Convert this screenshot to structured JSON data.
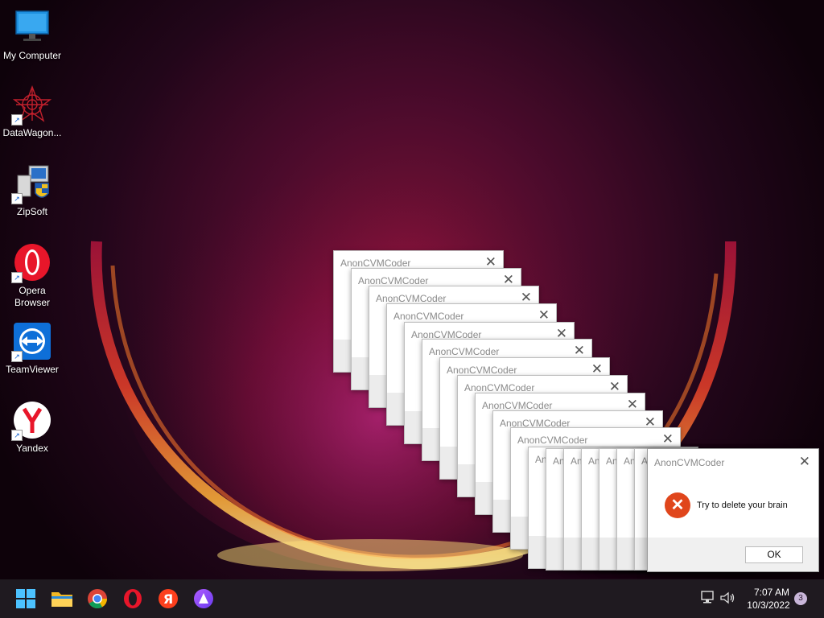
{
  "desktop": {
    "icons": [
      {
        "label": "My Computer",
        "icon": "monitor-icon",
        "shortcut": false
      },
      {
        "label": "DataWagon...",
        "icon": "datawagon-icon",
        "shortcut": true
      },
      {
        "label": "ZipSoft",
        "icon": "installer-icon",
        "shortcut": true
      },
      {
        "label": "Opera Browser",
        "icon": "opera-icon",
        "shortcut": true
      },
      {
        "label": "TeamViewer",
        "icon": "teamviewer-icon",
        "shortcut": true
      },
      {
        "label": "Yandex",
        "icon": "yandex-icon",
        "shortcut": true
      }
    ]
  },
  "dialogs": {
    "stack_title": "AnonCVMCoder",
    "stack_partial_title": "An",
    "close_glyph": "✕",
    "main": {
      "title": "AnonCVMCoder",
      "message": "Try to delete your brain",
      "ok_label": "OK",
      "icon": "error-icon",
      "icon_color": "#e0461c"
    }
  },
  "taskbar": {
    "apps": [
      "start-icon",
      "file-explorer-icon",
      "chrome-icon",
      "opera-icon",
      "yandex-browser-icon",
      "alice-icon"
    ],
    "tray": {
      "time": "7:07 AM",
      "date": "10/3/2022",
      "notification_count": "3"
    }
  },
  "colors": {
    "accent_glow": "#ff9a2a",
    "taskbar": "#1f1a20"
  }
}
